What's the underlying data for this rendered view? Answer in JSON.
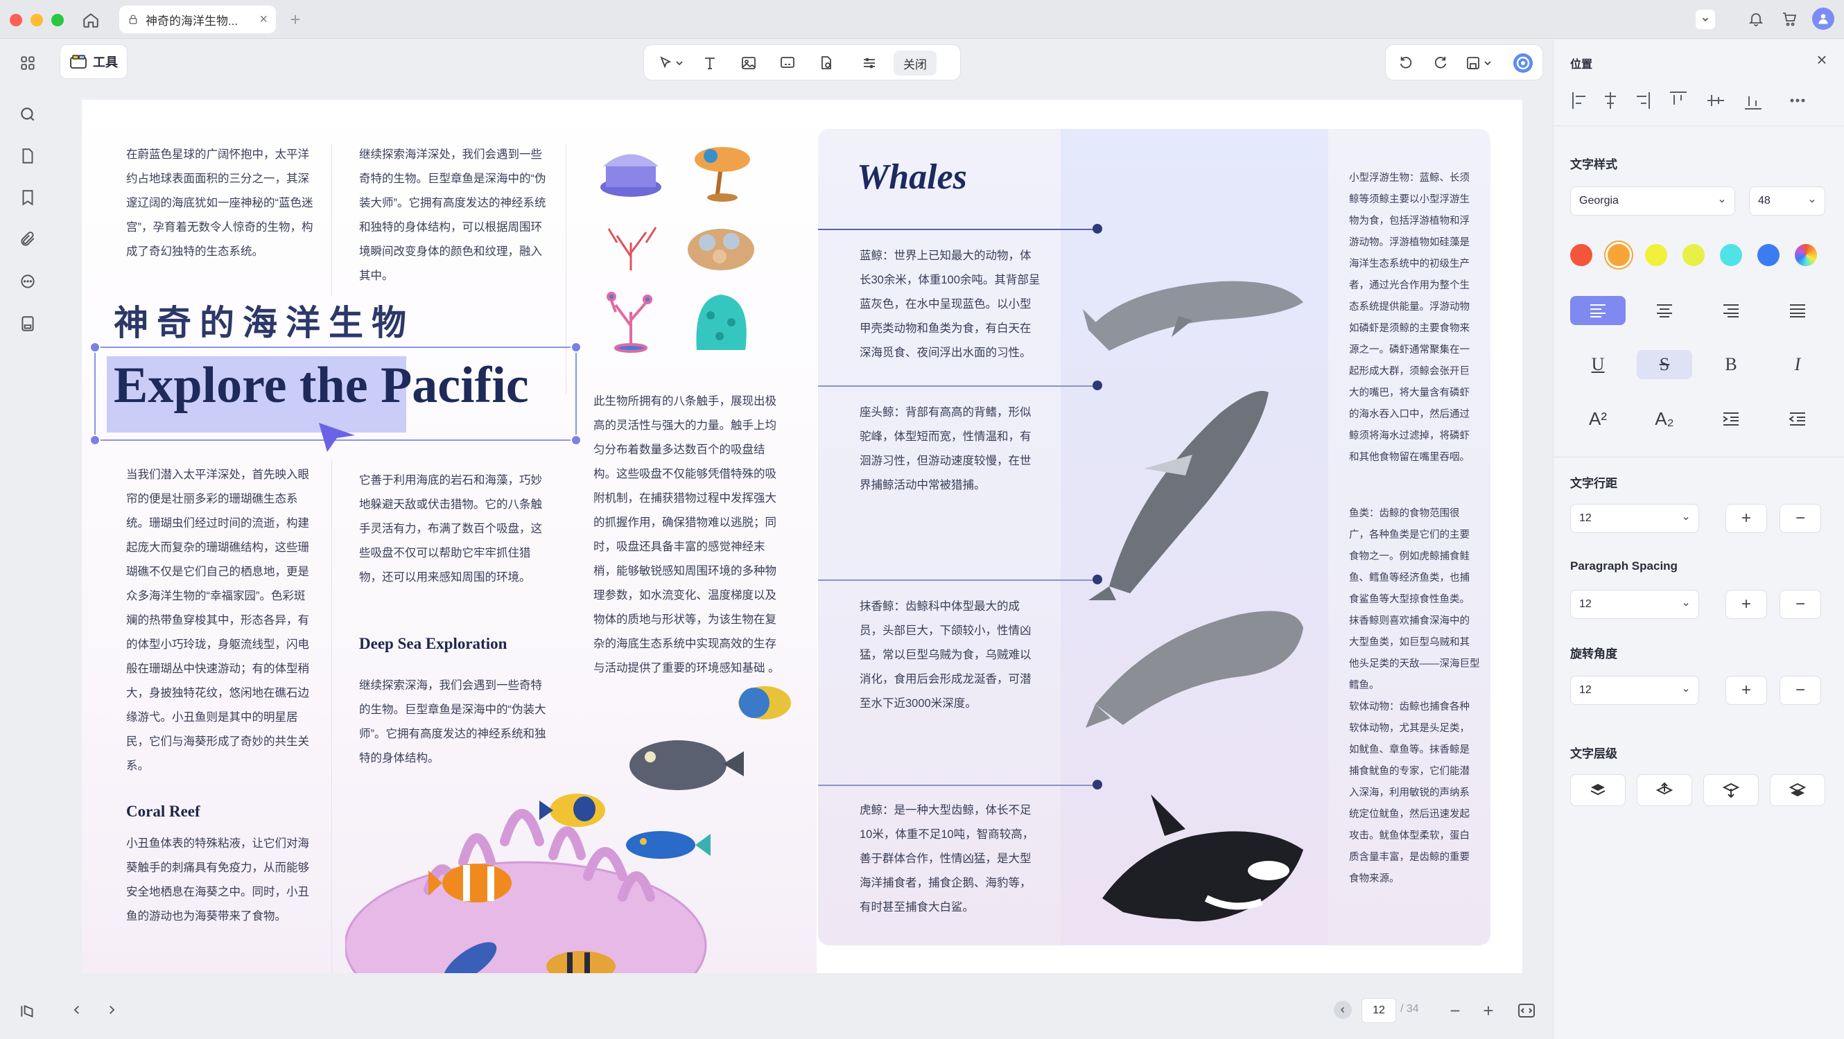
{
  "window": {
    "tab_title": "神奇的海洋生物...",
    "traffic_colors": [
      "#fe5f57",
      "#febc2e",
      "#28c840"
    ]
  },
  "toolbar": {
    "tools_label": "工具",
    "close_label": "关闭"
  },
  "document": {
    "left_page": {
      "intro_col1": [
        "在蔚蓝色星球的广阔怀抱中，太平洋",
        "约占地球表面面积的三分之一，其深",
        "邃辽阔的海底犹如一座神秘的“蓝色迷",
        "宫”，孕育着无数令人惊奇的生物，构",
        "成了奇幻独特的生态系统。"
      ],
      "intro_col2": [
        "继续探索海洋深处，我们会遇到一些",
        "奇特的生物。巨型章鱼是深海中的“伪",
        "装大师”。它拥有高度发达的神经系统",
        "和独特的身体结构，可以根据周围环",
        "境瞬间改变身体的颜色和纹理，融入",
        "其中。"
      ],
      "zh_title": "神奇的海洋生物",
      "en_title_part1": "Explore the",
      "en_title_part2": " Pacific",
      "body_col1": [
        "当我们潜入太平洋深处，首先映入眼",
        "帘的便是壮丽多彩的珊瑚礁生态系",
        "统。珊瑚虫们经过时间的流逝，构建",
        "起庞大而复杂的珊瑚礁结构，这些珊",
        "瑚礁不仅是它们自己的栖息地，更是",
        "众多海洋生物的“幸福家园”。色彩斑",
        "斓的热带鱼穿梭其中，形态各异，有",
        "的体型小巧玲珑，身躯流线型，闪电",
        "般在珊瑚丛中快速游动；有的体型稍",
        "大，身披独特花纹，悠闲地在礁石边",
        "缘游弋。小丑鱼则是其中的明星居",
        "民，它们与海葵形成了奇妙的共生关",
        "系。"
      ],
      "body_col2": [
        "它善于利用海底的岩石和海藻，巧妙",
        "地躲避天敌或伏击猎物。它的八条触",
        "手灵活有力，布满了数百个吸盘，这",
        "些吸盘不仅可以帮助它牢牢抓住猎",
        "物，还可以用来感知周围的环境。"
      ],
      "deep_sea_title": "Deep Sea Exploration",
      "deep_sea_text": [
        "继续探索深海，我们会遇到一些奇特",
        "的生物。巨型章鱼是深海中的“伪装大",
        "师”。它拥有高度发达的神经系统和独",
        "特的身体结构。"
      ],
      "coral_title": "Coral Reef",
      "coral_text": [
        "小丑鱼体表的特殊粘液，让它们对海",
        "葵触手的刺痛具有免疫力，从而能够",
        "安全地栖息在海葵之中。同时，小丑",
        "鱼的游动也为海葵带来了食物。"
      ],
      "body_col3": [
        "此生物所拥有的八条触手，展现出极",
        "高的灵活性与强大的力量。触手上均",
        "匀分布着数量多达数百个的吸盘结",
        "构。这些吸盘不仅能够凭借特殊的吸",
        "附机制，在捕获猎物过程中发挥强大",
        "的抓握作用，确保猎物难以逃脱；同",
        "时，吸盘还具备丰富的感觉神经末",
        "梢，能够敏锐感知周围环境的多种物",
        "理参数，如水流变化、温度梯度以及",
        "物体的质地与形状等，为该生物在复",
        "杂的海底生态系统中实现高效的生存",
        "与活动提供了重要的环境感知基础 。"
      ]
    },
    "right_page": {
      "title": "Whales",
      "entries": [
        [
          "蓝鲸：世界上已知最大的动物，体",
          "长30余米，体重100余吨。其背部呈",
          "蓝灰色，在水中呈现蓝色。以小型",
          "甲壳类动物和鱼类为食，有白天在",
          "深海觅食、夜间浮出水面的习性。"
        ],
        [
          "座头鲸：背部有高高的背鳍，形似",
          "驼峰，体型短而宽，性情温和，有",
          "洄游习性，但游动速度较慢，在世",
          "界捕鲸活动中常被猎捕。"
        ],
        [
          "抹香鲸：齿鲸科中体型最大的成",
          "员，头部巨大，下颌较小，性情凶",
          "猛，常以巨型乌贼为食，乌贼难以",
          "消化，食用后会形成龙涎香，可潜",
          "至水下近3000米深度。"
        ],
        [
          "虎鲸：是一种大型齿鲸，体长不足",
          "10米，体重不足10吨，智商较高，",
          "善于群体合作，性情凶猛，是大型",
          "海洋捕食者，捕食企鹅、海豹等，",
          "有时甚至捕食大白鲨。"
        ]
      ],
      "side_text_1": [
        "小型浮游生物：蓝鲸、长须",
        "鲸等须鲸主要以小型浮游生",
        "物为食，包括浮游植物和浮",
        "游动物。浮游植物如硅藻是",
        "海洋生态系统中的初级生产",
        "者，通过光合作用为整个生",
        "态系统提供能量。浮游动物",
        "如磷虾是须鲸的主要食物来",
        "源之一。磷虾通常聚集在一",
        "起形成大群，须鲸会张开巨",
        "大的嘴巴，将大量含有磷虾",
        "的海水吞入口中，然后通过",
        "鲸须将海水过滤掉，将磷虾",
        "和其他食物留在嘴里吞咽。"
      ],
      "side_text_2": [
        "鱼类：齿鲸的食物范围很",
        "广，各种鱼类是它们的主要",
        "食物之一。例如虎鲸捕食鲑",
        "鱼、鳕鱼等经济鱼类，也捕",
        "食鲨鱼等大型掠食性鱼类。",
        "抹香鲸则喜欢捕食深海中的",
        "大型鱼类，如巨型乌贼和其",
        "他头足类的天敌——深海巨型",
        "鳕鱼。",
        "软体动物：齿鲸也捕食各种",
        "软体动物，尤其是头足类，",
        "如鱿鱼、章鱼等。抹香鲸是",
        "捕食鱿鱼的专家，它们能潜",
        "入深海，利用敏锐的声纳系",
        "统定位鱿鱼，然后迅速发起",
        "攻击。鱿鱼体型柔软，蛋白",
        "质含量丰富，是齿鲸的重要",
        "食物来源。"
      ]
    }
  },
  "pager": {
    "current_page": "12",
    "total": "/ 34"
  },
  "panel": {
    "position_title": "位置",
    "text_style_title": "文字样式",
    "font_family": "Georgia",
    "font_size": "48",
    "colors": [
      "#f4553b",
      "#f7a534",
      "#f1f03a",
      "#e6f046",
      "#4fe3e6",
      "#3b7cf2",
      "rainbow"
    ],
    "line_spacing_title": "文字行距",
    "line_spacing_value": "12",
    "paragraph_spacing_title": "Paragraph Spacing",
    "paragraph_spacing_value": "12",
    "rotation_title": "旋转角度",
    "rotation_value": "12",
    "layer_title": "文字层级",
    "superscript": "A²",
    "subscript": "A₂",
    "bold": "B",
    "italic": "I",
    "underline": "U",
    "strikethrough": "S",
    "plus": "+",
    "minus": "−"
  }
}
